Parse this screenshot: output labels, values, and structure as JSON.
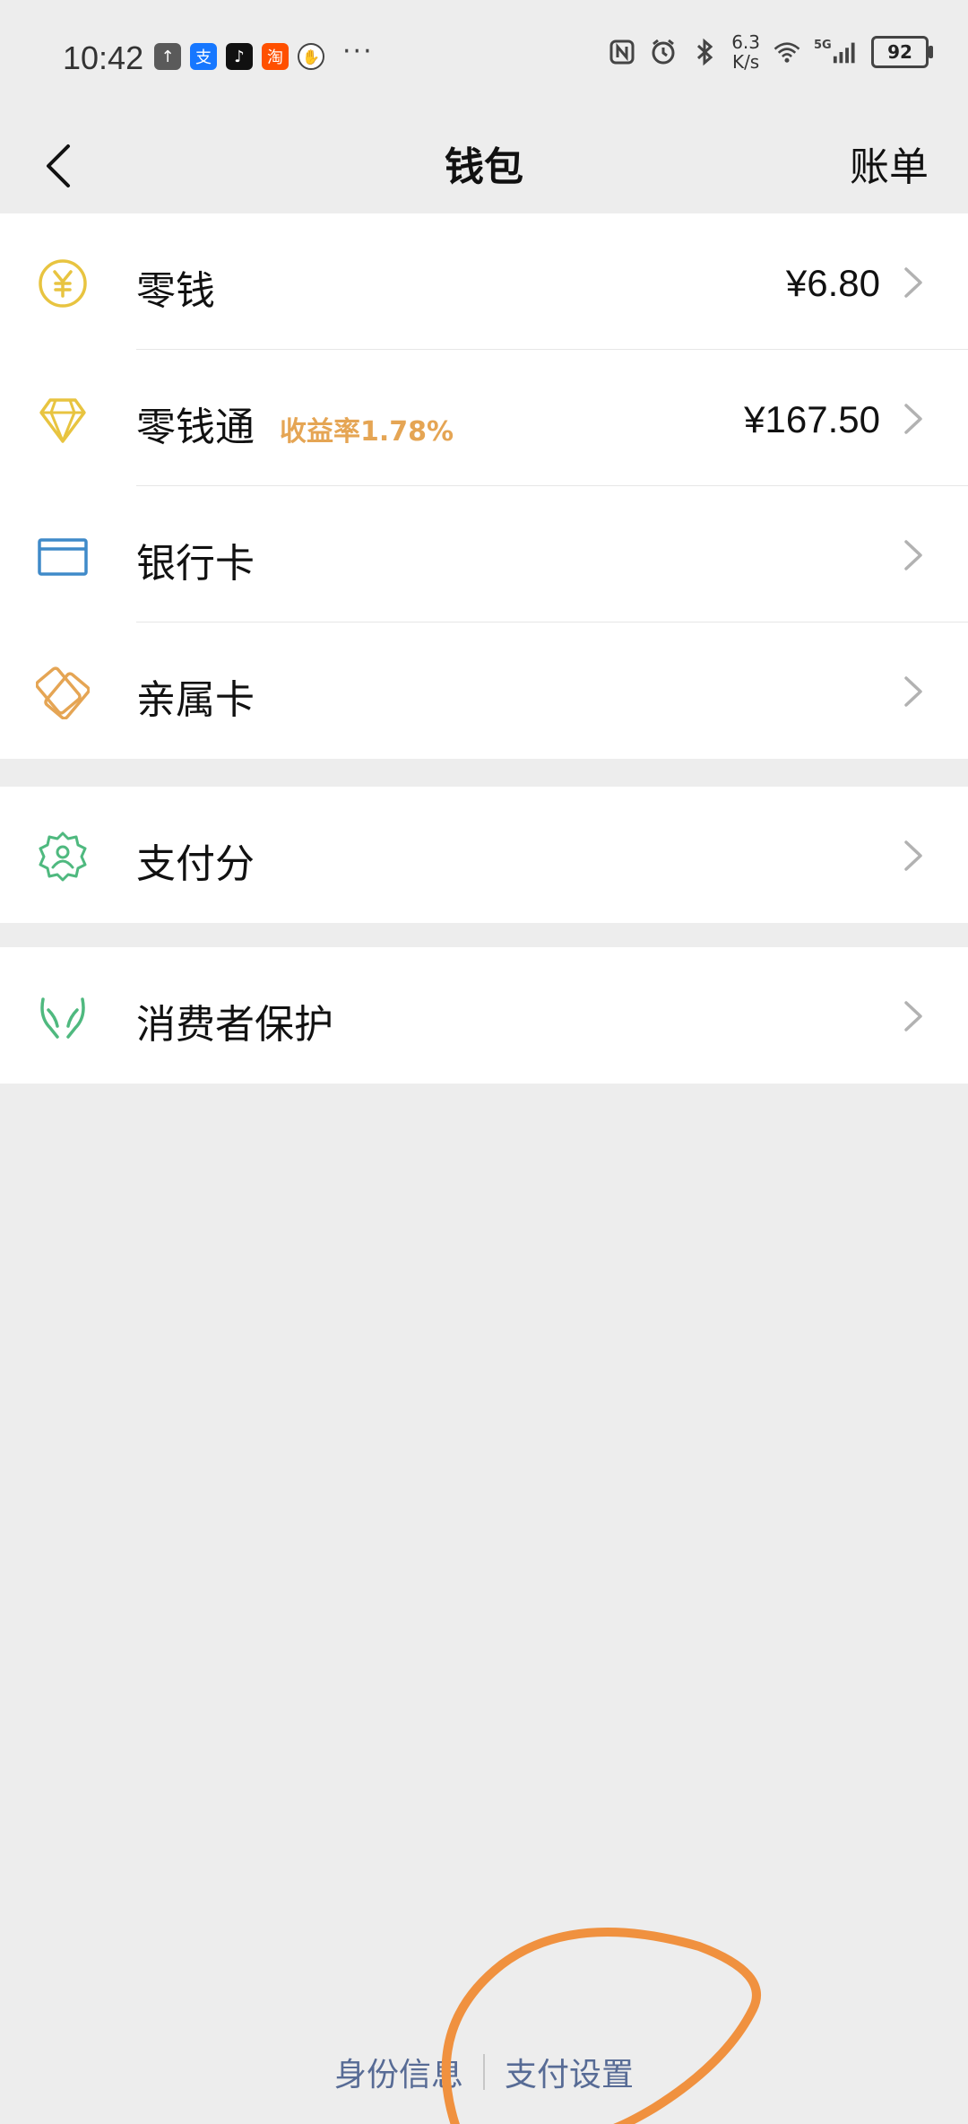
{
  "status_bar": {
    "time": "10:42",
    "apps": [
      {
        "icon": "upload-app-icon",
        "glyph": "↑",
        "color": "#5a5a5a"
      },
      {
        "icon": "alipay-icon",
        "glyph": "支",
        "color": "#1677ff"
      },
      {
        "icon": "douyin-icon",
        "glyph": "♪",
        "color": "#111111"
      },
      {
        "icon": "taobao-icon",
        "glyph": "淘",
        "color": "#ff5000"
      },
      {
        "icon": "hand-app-icon",
        "glyph": "✋",
        "color": "#ffffff"
      }
    ],
    "more": "···",
    "speed_value": "6.3",
    "speed_unit": "K/s",
    "network": "5G",
    "battery": "92"
  },
  "nav": {
    "title": "钱包",
    "right_action": "账单"
  },
  "wallet": {
    "items": [
      {
        "label": "零钱",
        "value": "¥6.80",
        "icon": "yuan-coin-icon"
      },
      {
        "label": "零钱通",
        "badge": "收益率1.78%",
        "value": "¥167.50",
        "icon": "diamond-icon"
      },
      {
        "label": "银行卡",
        "value": "",
        "icon": "bank-card-icon"
      },
      {
        "label": "亲属卡",
        "value": "",
        "icon": "family-card-icon"
      }
    ]
  },
  "score": {
    "label": "支付分",
    "icon": "pay-score-badge-icon"
  },
  "protection": {
    "label": "消费者保护",
    "icon": "consumer-protection-hands-icon"
  },
  "footer": {
    "identity": "身份信息",
    "pay_settings": "支付设置"
  },
  "colors": {
    "accent_yellow": "#e8c440",
    "card_blue": "#3f8ac9",
    "family_orange": "#e5a554",
    "green": "#4fb97f",
    "link": "#576b95",
    "annotation": "#f0913f"
  }
}
